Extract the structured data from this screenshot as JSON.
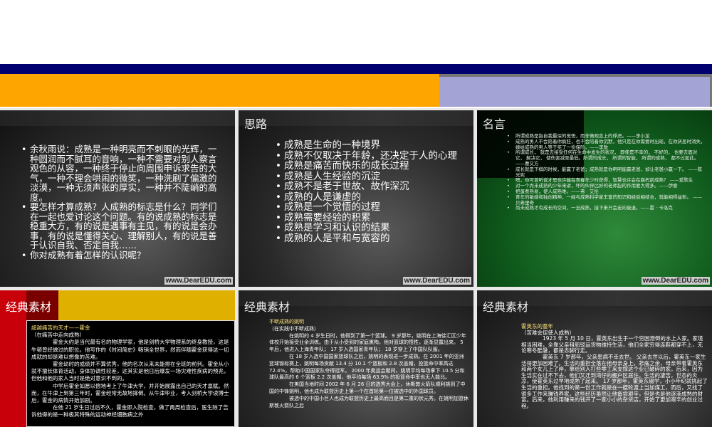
{
  "slides": [
    {
      "bullets": [
        "余秋雨说：成熟是一种明亮而不刺眼的光辉，一种圆润而不腻耳的音响，一种不需要对别人察言观色的从容，一种终于停止向周围申诉求告的大气，一种不理会哄闹的微笑，一种洗刷了偏激的淡漠，一种无须声张的厚实，一种并不陡峭的高度。",
        "要怎样才算成熟？人成熟的标志是什么？同学们在一起也爱讨论这个问题。有的说成熟的标志是稳重大方，有的说是遇事有主见，有的说是会办事，有的说是懂得关心、理解别人，有的说是善于认识自我、否定自我……",
        "你对成熟有着怎样的认识呢？"
      ],
      "watermark": "www.DearEDU.com"
    },
    {
      "title": "思路",
      "bullets": [
        "成熟是生命的一种境界",
        "成熟不仅取决于年龄，还决定于人的心理",
        "成熟是痛苦而快乐的成长过程",
        "成熟是人生经验的沉淀",
        "成熟不是老于世故、故作深沉",
        "成熟的人是谦虚的",
        "成熟是一个觉悟的过程",
        "成熟需要经验的积累",
        "成熟是学习和认识的结果",
        "成熟的人是平和与宽容的"
      ],
      "watermark": "www.DearEDU.com"
    },
    {
      "title": "名言",
      "bullets": [
        "所谓成熟是指自我最深的觉悟，而非做观念上的俘虏。——李小龙",
        "成熟的男人不会陪着你疯狂，也不会陪着你沉默，他只是在你需要时出现，在你厌恶时消失，嫁给成熟的男人等于买了一份保险。——李敖",
        "所谓成长， 就是去接受任何在生命中发生的状况， 即使是不幸的， 不好的， 也要去面对它， 解决它， 使伤害减至最低。所谓的成长， 所谓的智能， 所谓的成熟， 都不过如此。 ——曹又方",
        "成长就是下棋的时候，能赢了老爸；成熟就是你明明能赢老爸，却让老爸小赢一下。 ——陈光宪",
        "嗯，你可曾听说才思也许能在青春年少时获得，智慧也许会在腐朽前成熟？ ——爱默生",
        "对一个尚未成熟的少年来讲，坏的伙伴比好的老师起的作用要大得多。——伊索",
        "把蛋煮熟易，使人成熟难。——弗 · 艾伦",
        "青年的敏感和独创精神，一经与成熟科学家丰富的知识和经验相结合，就能相得益彰。 —— 贝弗里奇",
        "尚未成熟才有成长的空间，一旦成熟，接下来只会走向衰退。——雷 · 卡洛克"
      ],
      "watermark": "www.DearEDU.com"
    },
    {
      "title": "经典素材",
      "heading": "超越痛苦的天才——霍金",
      "sub": "（在痛苦中走向成熟）",
      "paras": [
        "霍金大约是当代最有名的物理学家，他是剑桥大学物理系的终身教授，这是牛顿曾经做过的职位。他写作的《时间简史》畅销全世界，然而伴随霍金获得这一切成就的却是难以想像的苦难。",
        "霍金幼时的成绩并不算优秀，他的名次从来未能排在全班的前列。霍金从小 就不擅长体育活动，身体协调性较差，这其实是他日后爆发一场灾难性疾病的预兆，但他和他的家人当时是绝对意识不到的。",
        "中学后霍金如愿以偿地考上了牛津大学，并开始展露出自己的天才禀赋。然而，在牛津上到第三年时，霍金经常无故地摔倒。从牛津毕业，考入剑桥大学读博士后，霍金的病情开始加剧。",
        "在他 21 岁生日过后不久，霍金即入院检查，做了两周检查后，医生除了告诉他得的是一种极其特殊的运动神经细胞病之外"
      ]
    },
    {
      "title": "经典素材",
      "heading": "不断成熟的姚明",
      "sub": "（在实践中不断成熟）",
      "paras": [
        "在姚明的 4 岁生日时，他得到了第一个篮球。 9 岁那年，姚明在上海徐汇区少年体校开始接受业余训练。由于从小受到的家庭熏陶，他对篮球的悟性，逐渐显露出来。 5 年后，他进入上海青年队； 17 岁入选国家青年队； 18 岁穿上了中国队队服。",
        "在 18 岁入选中国国家篮球队之后，姚明的表现进一步成熟。在 2001 年的亚洲篮球锦标赛上，姚明每场贡献 13.4 分 10.1 个篮板和 2.8 次盖帽，投篮命中率高达 72.4%，帮助中国国家队夺得冠军。 2000 年奥运会期间，姚明平均每场拿下 10.5 分和球队最高的 6 个篮板 2.2 次盖帽，他平均每场 63.9% 的投篮命中率也无人能比。",
        "在美国当地时间 2002 年 6 月 26 日的选秀大会上，休斯敦火箭队顺利挑到了中国的中锋姚明，他也成为联盟历史上第一个在首轮第一位被选中的外国球员。",
        "被选中的中国小巨人也成为联盟历史上最高而且是第二重的状元秀。在姚明加盟休斯敦火箭队之后"
      ]
    },
    {
      "title": "经典素材",
      "heading": "霍英东的童年",
      "sub": "（苦难会促使人成熟）",
      "paras": [
        "1923 年 5 月 10 日，霍英东出生于一个穷困潦倒的水上人家。家境相当困难，全靠父亲租船驳运货物维持生活，他们全家穷得连鞋都穿不上，无论寒冬酷暑，都是赤脚行走。",
        "霍英东 7 岁那年，父亲患病不幸去世。 父亲去世以后，霍英东一家生活得更加困难了。生活的重担全落在他母亲身上。悲痛之余，母亲带着霍英东和两个女儿上了岸，靠给别人打些零工来支撑这个业已破碎的家。后来，因为生活实在过不下去，他们又迁到湾仔的棚户区居住。生活的凄苦，世态的炎凉，使霍英东过早地成熟了起来。 17 岁那年，霍英东辍学，小小年纪就挑起了生活的重担。他找到的第一份工作就是在一艘轮渡上当加煤工，而后，又找了很多工作来赚钱养家。这些经历虽然让他备尝艰辛，但是也是他逐渐成熟的财富。后来，他利用赚来的钱开了一家小小的杂货店，开始了更加艰辛的创业过程。"
      ]
    }
  ]
}
